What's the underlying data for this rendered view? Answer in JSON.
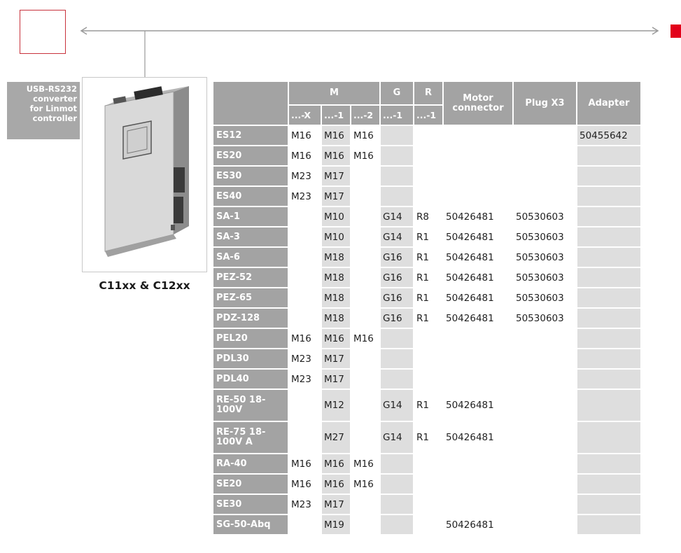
{
  "side_label": {
    "line1": "USB-RS232",
    "line2": "converter",
    "line3": "for Linmot",
    "line4": "controller"
  },
  "product": {
    "caption": "C11xx & C12xx"
  },
  "table": {
    "headers": {
      "M": "M",
      "G": "G",
      "R": "R",
      "motor_connector": "Motor connector",
      "plug_x3": "Plug X3",
      "adapter": "Adapter",
      "m_x": "...-X",
      "m_1": "...-1",
      "m_2": "...-2",
      "g_1": "...-1",
      "r_1": "...-1"
    },
    "rows": [
      {
        "label": "ES12",
        "mx": "M16",
        "m1": "M16",
        "m2": "M16",
        "g1": "",
        "r1": "",
        "motor": "",
        "plug": "",
        "adapter": "50455642"
      },
      {
        "label": "ES20",
        "mx": "M16",
        "m1": "M16",
        "m2": "M16",
        "g1": "",
        "r1": "",
        "motor": "",
        "plug": "",
        "adapter": ""
      },
      {
        "label": "ES30",
        "mx": "M23",
        "m1": "M17",
        "m2": "",
        "g1": "",
        "r1": "",
        "motor": "",
        "plug": "",
        "adapter": ""
      },
      {
        "label": "ES40",
        "mx": "M23",
        "m1": "M17",
        "m2": "",
        "g1": "",
        "r1": "",
        "motor": "",
        "plug": "",
        "adapter": ""
      },
      {
        "label": "SA-1",
        "mx": "",
        "m1": "M10",
        "m2": "",
        "g1": "G14",
        "r1": "R8",
        "motor": "50426481",
        "plug": "50530603",
        "adapter": ""
      },
      {
        "label": "SA-3",
        "mx": "",
        "m1": "M10",
        "m2": "",
        "g1": "G14",
        "r1": "R1",
        "motor": "50426481",
        "plug": "50530603",
        "adapter": ""
      },
      {
        "label": "SA-6",
        "mx": "",
        "m1": "M18",
        "m2": "",
        "g1": "G16",
        "r1": "R1",
        "motor": "50426481",
        "plug": "50530603",
        "adapter": ""
      },
      {
        "label": "PEZ-52",
        "mx": "",
        "m1": "M18",
        "m2": "",
        "g1": "G16",
        "r1": "R1",
        "motor": "50426481",
        "plug": "50530603",
        "adapter": ""
      },
      {
        "label": "PEZ-65",
        "mx": "",
        "m1": "M18",
        "m2": "",
        "g1": "G16",
        "r1": "R1",
        "motor": "50426481",
        "plug": "50530603",
        "adapter": ""
      },
      {
        "label": "PDZ-128",
        "mx": "",
        "m1": "M18",
        "m2": "",
        "g1": "G16",
        "r1": "R1",
        "motor": "50426481",
        "plug": "50530603",
        "adapter": ""
      },
      {
        "label": "PEL20",
        "mx": "M16",
        "m1": "M16",
        "m2": "M16",
        "g1": "",
        "r1": "",
        "motor": "",
        "plug": "",
        "adapter": ""
      },
      {
        "label": "PDL30",
        "mx": "M23",
        "m1": "M17",
        "m2": "",
        "g1": "",
        "r1": "",
        "motor": "",
        "plug": "",
        "adapter": ""
      },
      {
        "label": "PDL40",
        "mx": "M23",
        "m1": "M17",
        "m2": "",
        "g1": "",
        "r1": "",
        "motor": "",
        "plug": "",
        "adapter": ""
      },
      {
        "label": "RE-50 18-100V",
        "mx": "",
        "m1": "M12",
        "m2": "",
        "g1": "G14",
        "r1": "R1",
        "motor": "50426481",
        "plug": "",
        "adapter": ""
      },
      {
        "label": "RE-75 18-100V A",
        "mx": "",
        "m1": "M27",
        "m2": "",
        "g1": "G14",
        "r1": "R1",
        "motor": "50426481",
        "plug": "",
        "adapter": ""
      },
      {
        "label": "RA-40",
        "mx": "M16",
        "m1": "M16",
        "m2": "M16",
        "g1": "",
        "r1": "",
        "motor": "",
        "plug": "",
        "adapter": ""
      },
      {
        "label": "SE20",
        "mx": "M16",
        "m1": "M16",
        "m2": "M16",
        "g1": "",
        "r1": "",
        "motor": "",
        "plug": "",
        "adapter": ""
      },
      {
        "label": "SE30",
        "mx": "M23",
        "m1": "M17",
        "m2": "",
        "g1": "",
        "r1": "",
        "motor": "",
        "plug": "",
        "adapter": ""
      },
      {
        "label": "SG-50-Abq",
        "mx": "",
        "m1": "M19",
        "m2": "",
        "g1": "",
        "r1": "",
        "motor": "50426481",
        "plug": "",
        "adapter": ""
      }
    ]
  },
  "colors": {
    "header_gray": "#a3a3a3",
    "cell_gray": "#dedede",
    "accent_red": "#e2001a",
    "box_red": "#c8323c"
  }
}
